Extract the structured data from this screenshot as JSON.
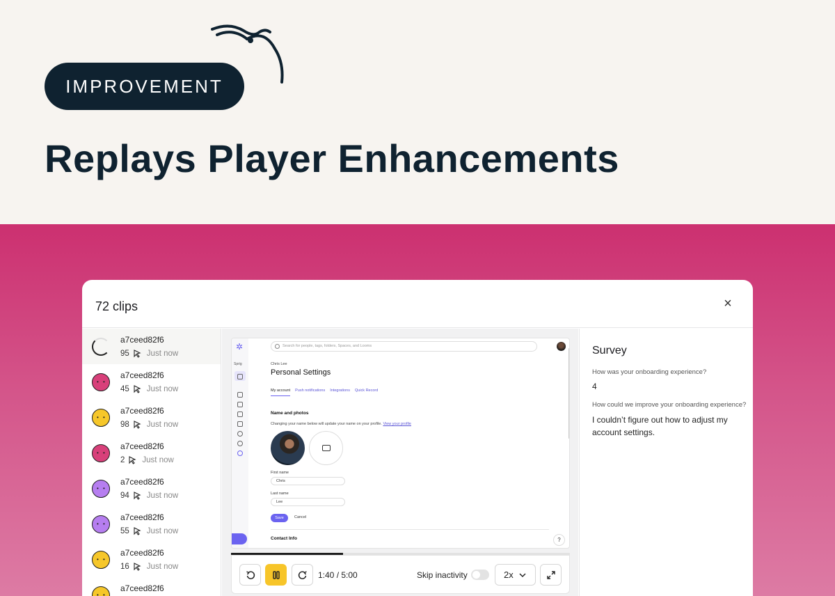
{
  "badge": "IMPROVEMENT",
  "headline": "Replays Player Enhancements",
  "modal": {
    "title": "72 clips",
    "close_icon": "×"
  },
  "clips": [
    {
      "name": "a7ceed82f6",
      "count": "95",
      "time": "Just now",
      "avatar": "loading-spinner",
      "color": ""
    },
    {
      "name": "a7ceed82f6",
      "count": "45",
      "time": "Just now",
      "avatar": "face-icon",
      "color": "#d8407a"
    },
    {
      "name": "a7ceed82f6",
      "count": "98",
      "time": "Just now",
      "avatar": "face-icon",
      "color": "#f6c72a"
    },
    {
      "name": "a7ceed82f6",
      "count": "2",
      "time": "Just now",
      "avatar": "face-icon",
      "color": "#d8407a"
    },
    {
      "name": "a7ceed82f6",
      "count": "94",
      "time": "Just now",
      "avatar": "face-icon",
      "color": "#b67ef0"
    },
    {
      "name": "a7ceed82f6",
      "count": "55",
      "time": "Just now",
      "avatar": "face-icon",
      "color": "#b67ef0"
    },
    {
      "name": "a7ceed82f6",
      "count": "16",
      "time": "Just now",
      "avatar": "face-icon",
      "color": "#f6c72a"
    },
    {
      "name": "a7ceed82f6",
      "count": "",
      "time": "",
      "avatar": "face-icon",
      "color": "#f6c72a"
    }
  ],
  "screen": {
    "rail_label": "Sprig",
    "search_placeholder": "Search for people, tags, folders, Spaces, and Looms",
    "crumb": "Chris Lee",
    "title": "Personal Settings",
    "tabs": [
      "My account",
      "Push notifications",
      "Integrations",
      "Quick Record"
    ],
    "section_heading": "Name and photos",
    "section_desc": "Changing your name below will update your name on your profile.",
    "section_link": "View your profile",
    "first_name_label": "First name",
    "first_name_value": "Chris",
    "last_name_label": "Last name",
    "last_name_value": "Lee",
    "save_label": "Save",
    "cancel_label": "Cancel",
    "contact_heading": "Contact Info",
    "help_label": "?"
  },
  "player": {
    "time_readout": "1:40 / 5:00",
    "progress": 0.33,
    "skip_label": "Skip inactivity",
    "skip_enabled": false,
    "speed": "2x"
  },
  "survey": {
    "title": "Survey",
    "q1": "How was your onboarding experience?",
    "a1": "4",
    "q2": "How could we improve your onboarding experience?",
    "a2": "I couldn’t figure out how to adjust my account settings."
  },
  "colors": {
    "navy": "#0f2230",
    "pink": "#cc3070",
    "accent": "#6b63f0",
    "pause": "#f7c529"
  }
}
